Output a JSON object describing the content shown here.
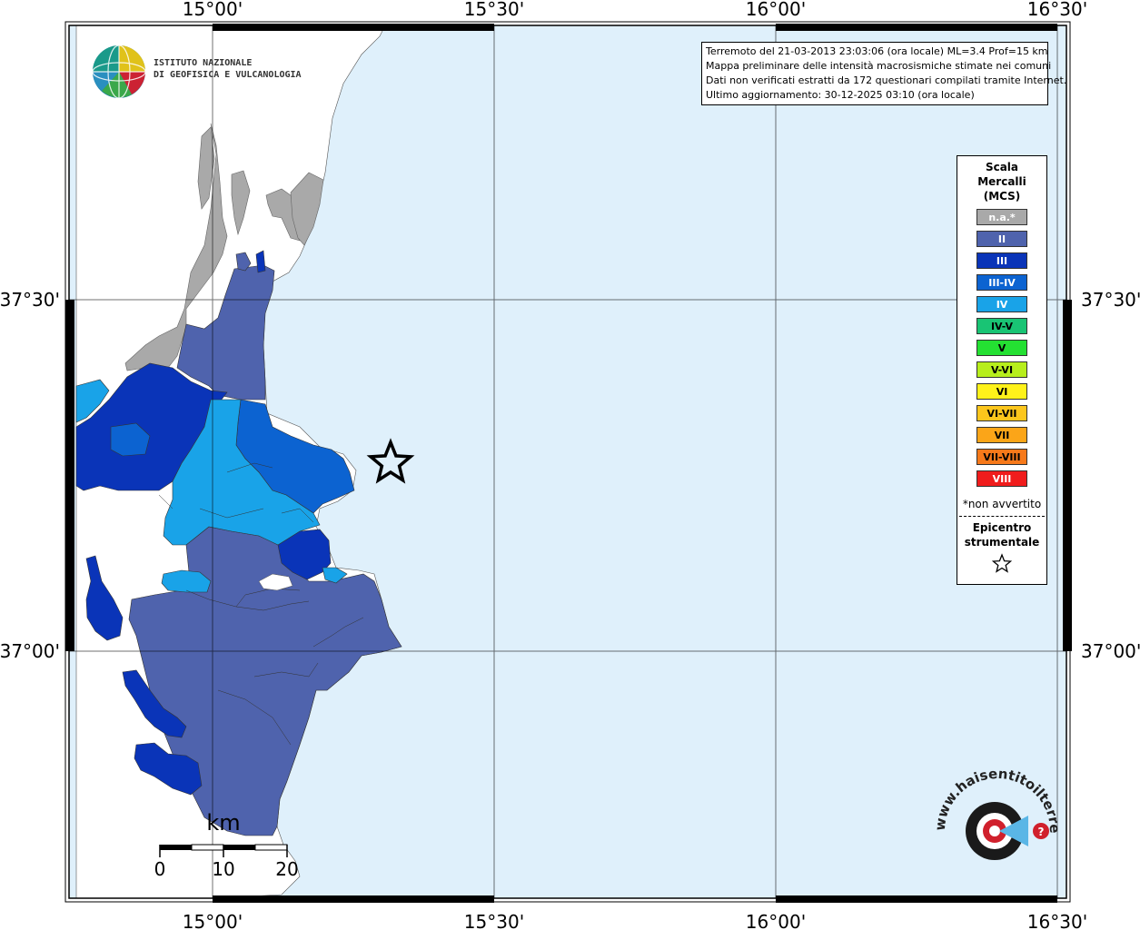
{
  "header": {
    "org_line1": "ISTITUTO NAZIONALE",
    "org_line2": "DI GEOFISICA E VULCANOLOGIA"
  },
  "info": {
    "line1": "Terremoto del 21-03-2013 23:03:06 (ora locale) ML=3.4 Prof=15 km",
    "line2": "Mappa preliminare delle intensità macrosismiche stimate nei comuni",
    "line3": "Dati non verificati estratti da 172 questionari compilati tramite Internet.",
    "line4": "Ultimo aggiornamento: 30-12-2025 03:10 (ora locale)"
  },
  "axes": {
    "lon_labels": [
      "15°00'",
      "15°30'",
      "16°00'",
      "16°30'"
    ],
    "lat_labels": [
      "37°30'",
      "37°00'"
    ]
  },
  "legend": {
    "title_line1": "Scala",
    "title_line2": "Mercalli",
    "title_line3": "(MCS)",
    "items": [
      {
        "label": "n.a.*",
        "color": "#a9a9a9",
        "text_color": "#ffffff"
      },
      {
        "label": "II",
        "color": "#4f63ad",
        "text_color": "#ffffff"
      },
      {
        "label": "III",
        "color": "#0a34b8",
        "text_color": "#ffffff"
      },
      {
        "label": "III-IV",
        "color": "#0c63d1",
        "text_color": "#ffffff"
      },
      {
        "label": "IV",
        "color": "#19a3e8",
        "text_color": "#ffffff"
      },
      {
        "label": "IV-V",
        "color": "#19c474",
        "text_color": "#000000"
      },
      {
        "label": "V",
        "color": "#24e032",
        "text_color": "#000000"
      },
      {
        "label": "V-VI",
        "color": "#b7ee1c",
        "text_color": "#000000"
      },
      {
        "label": "VI",
        "color": "#fff21a",
        "text_color": "#000000"
      },
      {
        "label": "VI-VII",
        "color": "#fcc61c",
        "text_color": "#000000"
      },
      {
        "label": "VII",
        "color": "#fba518",
        "text_color": "#000000"
      },
      {
        "label": "VII-VIII",
        "color": "#f7791a",
        "text_color": "#000000"
      },
      {
        "label": "VIII",
        "color": "#f01c1c",
        "text_color": "#ffffff"
      }
    ],
    "note": "*non avvertito",
    "epicenter_line1": "Epicentro",
    "epicenter_line2": "strumentale"
  },
  "scale_bar": {
    "unit": "km",
    "labels": [
      "0",
      "10",
      "20"
    ]
  },
  "watermark": {
    "text": "www.haisentitoilterremoto.it"
  },
  "colors": {
    "sea": "#dff0fb",
    "land": "#ffffff",
    "na": "#a9a9a9",
    "ii": "#4f63ad",
    "iii": "#0a34b8",
    "iii_iv": "#0c63d1",
    "iv": "#19a3e8"
  }
}
